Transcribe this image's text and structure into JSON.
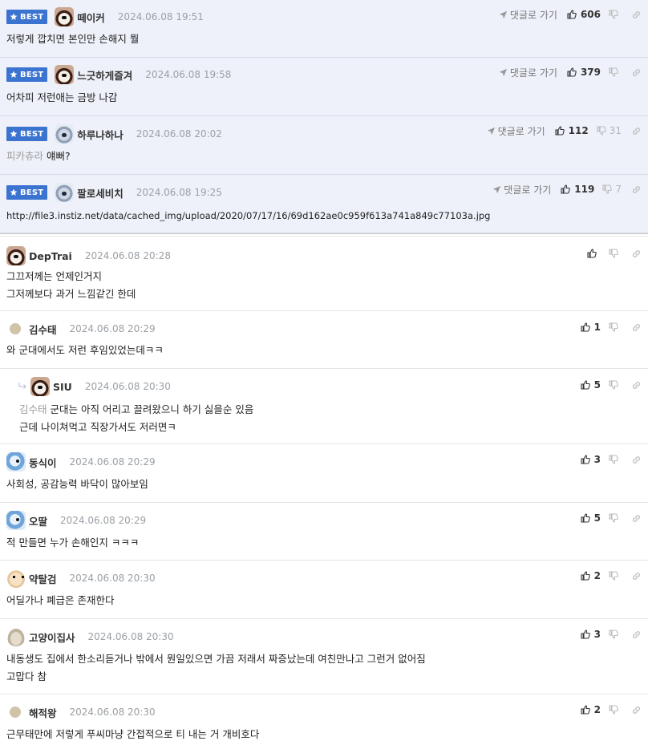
{
  "labels": {
    "best": "BEST",
    "go_to_reply": "댓글로 가기"
  },
  "best_comments": [
    {
      "nick": "떼이커",
      "date": "2024.06.08 19:51",
      "up": "606",
      "down": "",
      "text": "저렇게 깝치면 본인만 손해지 뭘",
      "quote": "",
      "avatar": "dog-icon"
    },
    {
      "nick": "느긋하게즐겨",
      "date": "2024.06.08 19:58",
      "up": "379",
      "down": "",
      "text": "어차피 저런애는 금방 나감",
      "quote": "",
      "avatar": "dog-icon"
    },
    {
      "nick": "하루나하나",
      "date": "2024.06.08 20:02",
      "up": "112",
      "down": "31",
      "text": "얘뻐?",
      "quote": "피카츄라",
      "avatar": "koala-icon"
    },
    {
      "nick": "팔로세비치",
      "date": "2024.06.08 19:25",
      "up": "119",
      "down": "7",
      "text": "http://file3.instiz.net/data/cached_img/upload/2020/07/17/16/69d162ae0c959f613a741a849c77103a.jpg",
      "quote": "",
      "avatar": "koala-icon"
    }
  ],
  "comments": [
    {
      "nick": "DepTrai",
      "date": "2024.06.08 20:28",
      "up": "",
      "lines": [
        "그끄저께는 언제인거지",
        "그저께보다 과거 느낌같긴 한데"
      ],
      "quote": "",
      "avatar": "dog-icon"
    },
    {
      "nick": "김수태",
      "date": "2024.06.08 20:29",
      "up": "1",
      "lines": [
        "와 군대에서도 저런 후임있었는데ㅋㅋ"
      ],
      "quote": "",
      "avatar": "dot-icon"
    },
    {
      "nick": "SIU",
      "date": "2024.06.08 20:30",
      "up": "5",
      "lines": [
        "군대는 아직 어리고 끌려왔으니 하기 싫을순 있음",
        "근데 나이쳐먹고 직장가서도 저러면ㅋ"
      ],
      "quote": "김수태",
      "avatar": "dog-icon",
      "is_reply": true
    },
    {
      "nick": "동식이",
      "date": "2024.06.08 20:29",
      "up": "3",
      "lines": [
        "사회성, 공감능력 바닥이 많아보임"
      ],
      "quote": "",
      "avatar": "bird-icon"
    },
    {
      "nick": "오딸",
      "date": "2024.06.08 20:29",
      "up": "5",
      "lines": [
        "적 만들면 누가 손해인지 ㅋㅋㅋ"
      ],
      "quote": "",
      "avatar": "bird-icon"
    },
    {
      "nick": "약탈검",
      "date": "2024.06.08 20:30",
      "up": "2",
      "lines": [
        "어딜가나 폐급은 존재한다"
      ],
      "quote": "",
      "avatar": "chihuahua-icon"
    },
    {
      "nick": "고양이집사",
      "date": "2024.06.08 20:30",
      "up": "3",
      "lines": [
        "내동생도 집에서 한소리듣거나 밖에서 뭔일있으면 가끔 저래서 짜증났는데 여친만나고 그런거 없어짐",
        "고맙다 참"
      ],
      "quote": "",
      "avatar": "cat-icon"
    },
    {
      "nick": "해적왕",
      "date": "2024.06.08 20:30",
      "up": "2",
      "lines": [
        "근무태만에 저렇게 푸씨마냥 간접적으로 티 내는 거 개비호다"
      ],
      "quote": "",
      "avatar": "dot-icon"
    }
  ]
}
